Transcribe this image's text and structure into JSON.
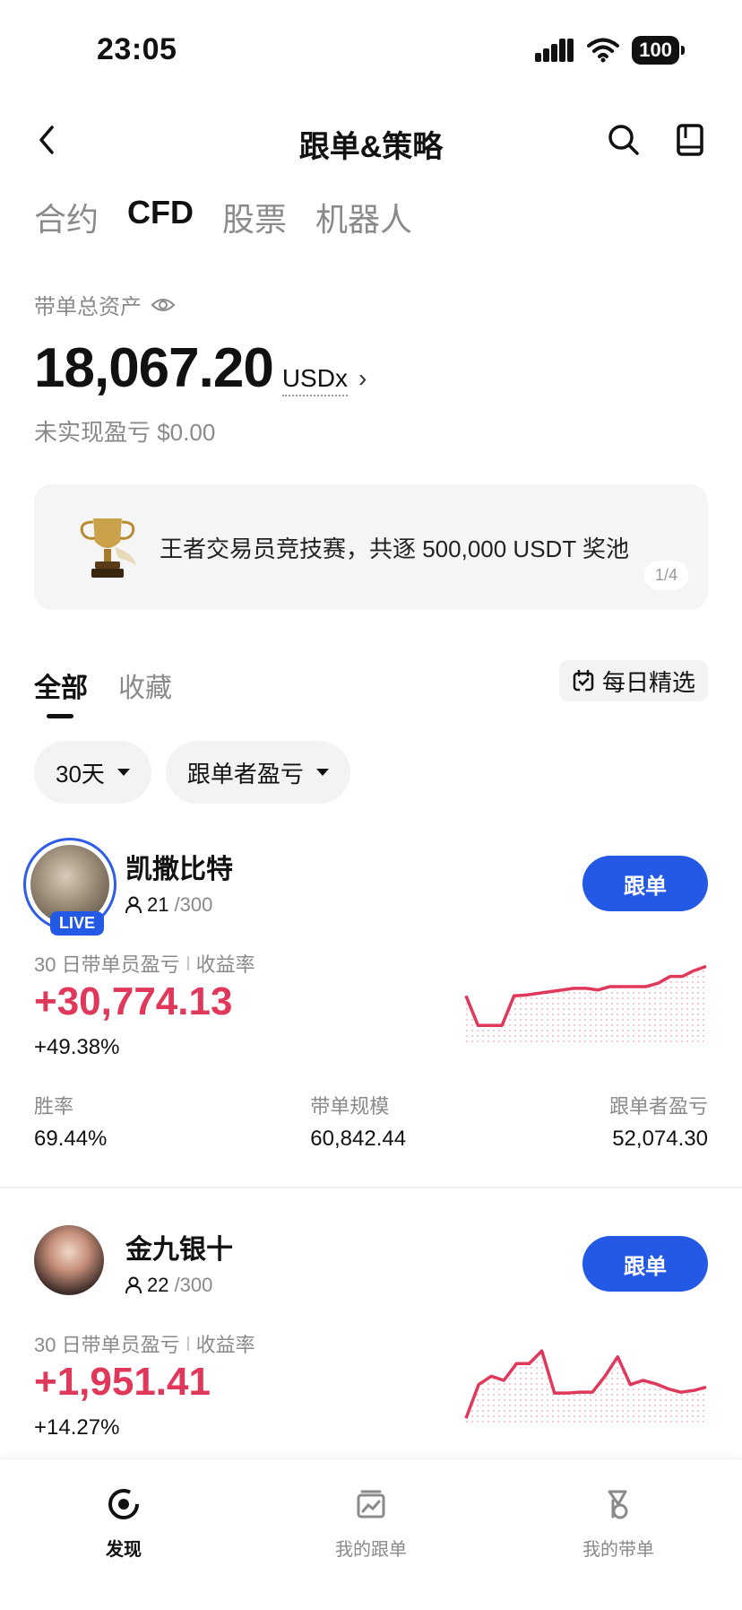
{
  "status_bar": {
    "time": "23:05",
    "battery": "100"
  },
  "header": {
    "title": "跟单&策略"
  },
  "top_tabs": [
    {
      "label": "合约",
      "active": false
    },
    {
      "label": "CFD",
      "active": true
    },
    {
      "label": "股票",
      "active": false
    },
    {
      "label": "机器人",
      "active": false
    }
  ],
  "assets": {
    "label": "带单总资产",
    "amount": "18,067.20",
    "unit": "USDx",
    "unrealized": "未实现盈亏 $0.00"
  },
  "banner": {
    "text": "王者交易员竞技赛，共逐 500,000 USDT 奖池",
    "pager": "1/4"
  },
  "sub_tabs": {
    "all": "全部",
    "favorites": "收藏",
    "daily_pick": "每日精选"
  },
  "filters": [
    "30天",
    "跟单者盈亏"
  ],
  "traders": [
    {
      "name": "凯撒比特",
      "live_badge": "LIVE",
      "followers": "21",
      "max_followers": "/300",
      "follow_label": "跟单",
      "metric_label_a": "30 日带单员盈亏",
      "metric_label_b": "收益率",
      "pnl": "+30,774.13",
      "rate": "+49.38%",
      "sparkline": [
        0.55,
        0.2,
        0.2,
        0.2,
        0.55,
        0.56,
        0.58,
        0.6,
        0.62,
        0.64,
        0.64,
        0.62,
        0.66,
        0.66,
        0.66,
        0.66,
        0.7,
        0.78,
        0.78,
        0.85,
        0.9
      ],
      "stats": [
        {
          "label": "胜率",
          "value": "69.44%"
        },
        {
          "label": "带单规模",
          "value": "60,842.44"
        },
        {
          "label": "跟单者盈亏",
          "value": "52,074.30"
        }
      ]
    },
    {
      "name": "金九银十",
      "followers": "22",
      "max_followers": "/300",
      "follow_label": "跟单",
      "metric_label_a": "30 日带单员盈亏",
      "metric_label_b": "收益率",
      "pnl": "+1,951.41",
      "rate": "+14.27%",
      "sparkline": [
        0.05,
        0.45,
        0.55,
        0.5,
        0.7,
        0.7,
        0.85,
        0.35,
        0.35,
        0.36,
        0.36,
        0.55,
        0.78,
        0.45,
        0.5,
        0.46,
        0.4,
        0.36,
        0.38,
        0.42
      ],
      "sparkline_color": "#e0385a"
    }
  ],
  "bottom_nav": [
    {
      "label": "发现",
      "active": true,
      "icon": "discover-icon"
    },
    {
      "label": "我的跟单",
      "active": false,
      "icon": "my-copy-icon"
    },
    {
      "label": "我的带单",
      "active": false,
      "icon": "my-lead-icon"
    }
  ],
  "colors": {
    "accent": "#2459e6",
    "profit": "#e0385a"
  }
}
